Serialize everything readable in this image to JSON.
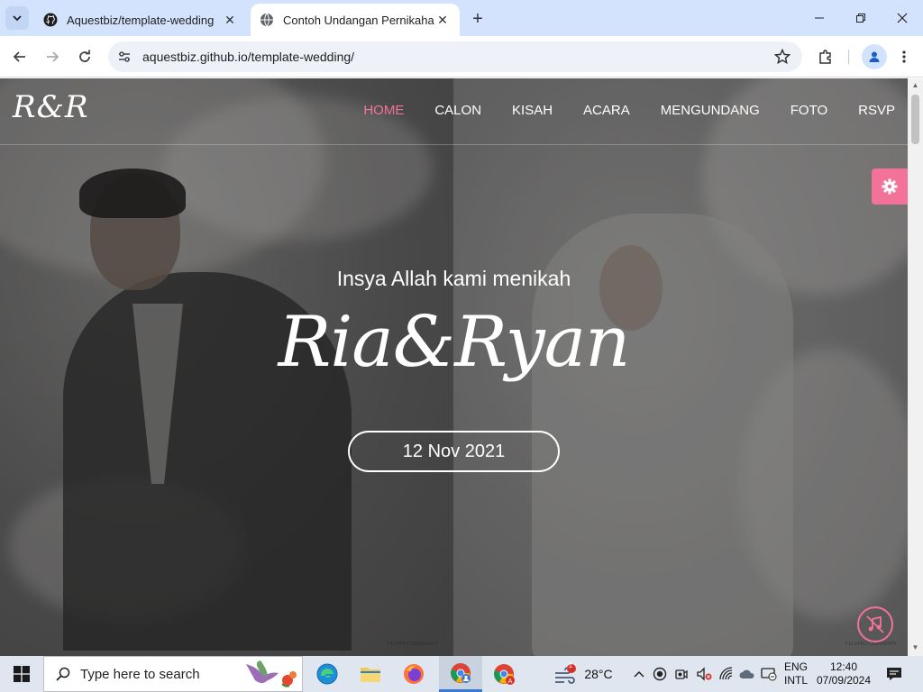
{
  "browser": {
    "tabs": [
      {
        "title": "Aquestbiz/template-wedding",
        "icon": "github-icon",
        "active": false
      },
      {
        "title": "Contoh Undangan Pernikahan",
        "icon": "globe-icon",
        "active": true
      }
    ],
    "url": "aquestbiz.github.io/template-wedding/"
  },
  "page": {
    "logo": "R&R",
    "nav": [
      "HOME",
      "CALON",
      "KISAH",
      "ACARA",
      "MENGUNDANG",
      "FOTO",
      "RSVP"
    ],
    "active_nav": "HOME",
    "hero": {
      "subtitle": "Insya Allah kami menikah",
      "names": "Ria&Ryan",
      "date": "12 Nov 2021"
    },
    "watermark": "FO PHOTOGRAPHY",
    "accent_color": "#f3729a"
  },
  "taskbar": {
    "search_placeholder": "Type here to search",
    "weather": "28°C",
    "weather_badge": "1",
    "lang_top": "ENG",
    "lang_bottom": "INTL",
    "time": "12:40",
    "date": "07/09/2024"
  }
}
